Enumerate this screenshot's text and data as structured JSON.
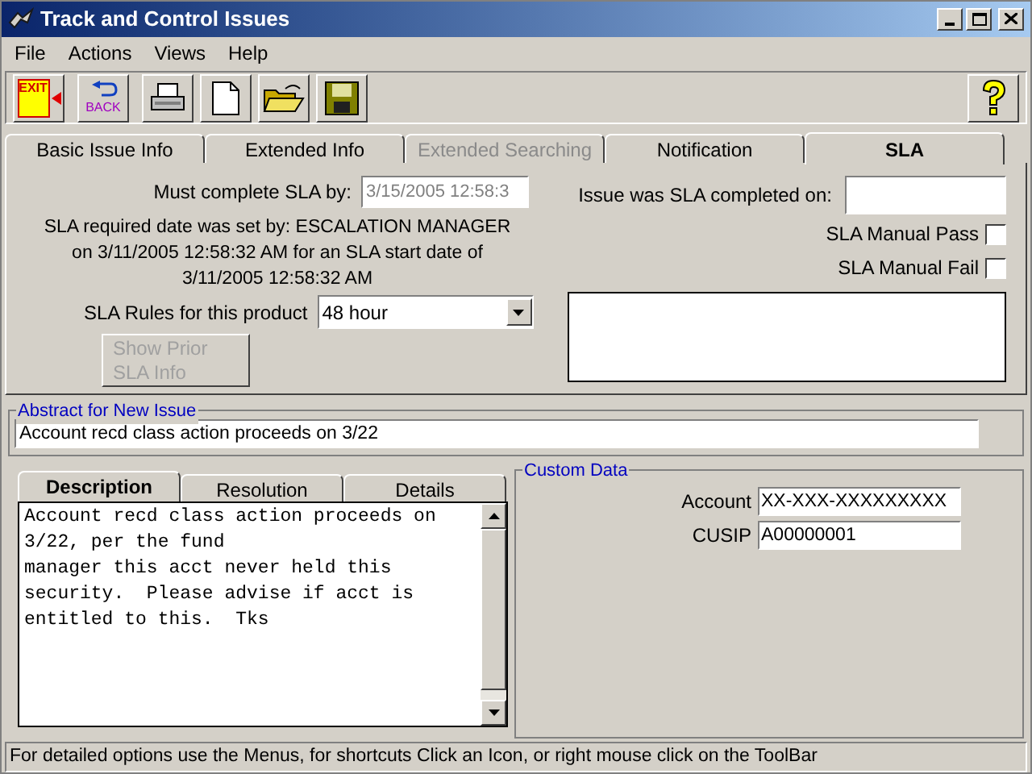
{
  "window": {
    "title": "Track and Control Issues"
  },
  "menu": [
    "File",
    "Actions",
    "Views",
    "Help"
  ],
  "toolbar": {
    "exit_label": "EXIT",
    "back_label": "BACK"
  },
  "tabs": [
    {
      "label": "Basic Issue Info",
      "selected": false,
      "disabled": false
    },
    {
      "label": "Extended Info",
      "selected": false,
      "disabled": false
    },
    {
      "label": "Extended Searching",
      "selected": false,
      "disabled": true
    },
    {
      "label": "Notification",
      "selected": false,
      "disabled": false
    },
    {
      "label": "SLA",
      "selected": true,
      "disabled": false
    }
  ],
  "sla": {
    "must_complete_label": "Must complete SLA by:",
    "must_complete_value": "3/15/2005 12:58:3",
    "must_complete_disabled": true,
    "message": "SLA required date was set by: ESCALATION MANAGER on 3/11/2005 12:58:32 AM for an SLA start date of 3/11/2005 12:58:32 AM",
    "rules_label": "SLA Rules for this product",
    "rules_value": "48 hour",
    "prior_button": {
      "label": "Show Prior SLA Info",
      "disabled": true
    },
    "completed_label": "Issue was SLA completed on:",
    "checks": [
      {
        "label": "SLA Manual Pass",
        "checked": false
      },
      {
        "label": "SLA Manual Fail",
        "checked": false
      }
    ]
  },
  "abstract": {
    "legend": "Abstract for New Issue",
    "value": "Account recd class action proceeds on 3/22"
  },
  "detail_tabs": [
    {
      "label": "Description",
      "selected": true
    },
    {
      "label": "Resolution",
      "selected": false
    },
    {
      "label": "Details",
      "selected": false
    }
  ],
  "description": "Account recd class action proceeds on 3/22, per the fund\nmanager this acct never held this security.  Please advise if acct is entitled to this.  Tks",
  "custom_data": {
    "legend": "Custom Data",
    "fields": [
      {
        "label": "Account",
        "value": "XX-XXX-XXXXXXXXX"
      },
      {
        "label": "CUSIP",
        "value": "A00000001"
      }
    ]
  },
  "status_bar": "For detailed options use the Menus, for shortcuts Click an Icon, or right mouse click on the ToolBar"
}
